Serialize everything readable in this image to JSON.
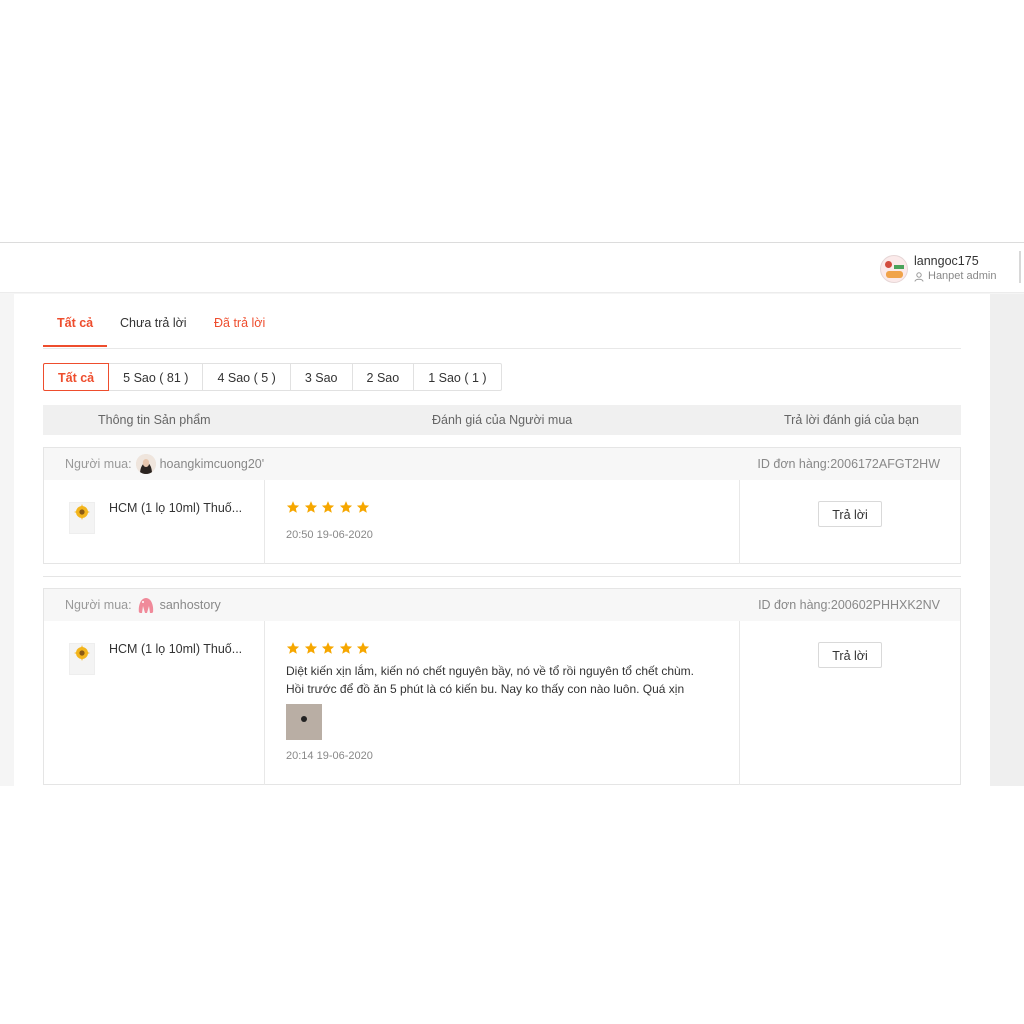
{
  "header": {
    "username": "lanngoc175",
    "role": "Hanpet admin"
  },
  "tabs": [
    {
      "label": "Tất cả"
    },
    {
      "label": "Chưa trả lời"
    },
    {
      "label": "Đã trả lời"
    }
  ],
  "filters": [
    {
      "label": "Tất cả"
    },
    {
      "label": "5 Sao ( 81 )"
    },
    {
      "label": "4 Sao ( 5 )"
    },
    {
      "label": "3 Sao"
    },
    {
      "label": "2 Sao"
    },
    {
      "label": "1 Sao ( 1 )"
    }
  ],
  "table_headers": {
    "product": "Thông tin Sản phẩm",
    "buyer_review": "Đánh giá của Người mua",
    "your_reply": "Trả lời đánh giá của bạn"
  },
  "reviews": [
    {
      "buyer_label": "Người mua:",
      "buyer_name": "hoangkimcuong20'",
      "order_id": "ID đơn hàng:2006172AFGT2HW",
      "product_name": "HCM (1 lọ 10ml) Thuố...",
      "rating": 5,
      "comment_line1": "",
      "comment_line2": "",
      "time": "20:50 19-06-2020",
      "reply_label": "Trả lời"
    },
    {
      "buyer_label": "Người mua:",
      "buyer_name": "sanhostory",
      "order_id": "ID đơn hàng:200602PHHXK2NV",
      "product_name": "HCM (1 lọ 10ml) Thuố...",
      "rating": 5,
      "comment_line1": "Diệt kiến xịn lắm, kiến nó chết nguyên bầy, nó về tổ rồi nguyên tổ chết chùm.",
      "comment_line2": "Hồi trước để đồ ăn 5 phút là có kiến bu. Nay ko thấy con nào luôn. Quá xịn",
      "time": "20:14 19-06-2020",
      "reply_label": "Trả lời"
    }
  ],
  "colors": {
    "accent": "#ee4d2d",
    "star": "#f6a700"
  }
}
